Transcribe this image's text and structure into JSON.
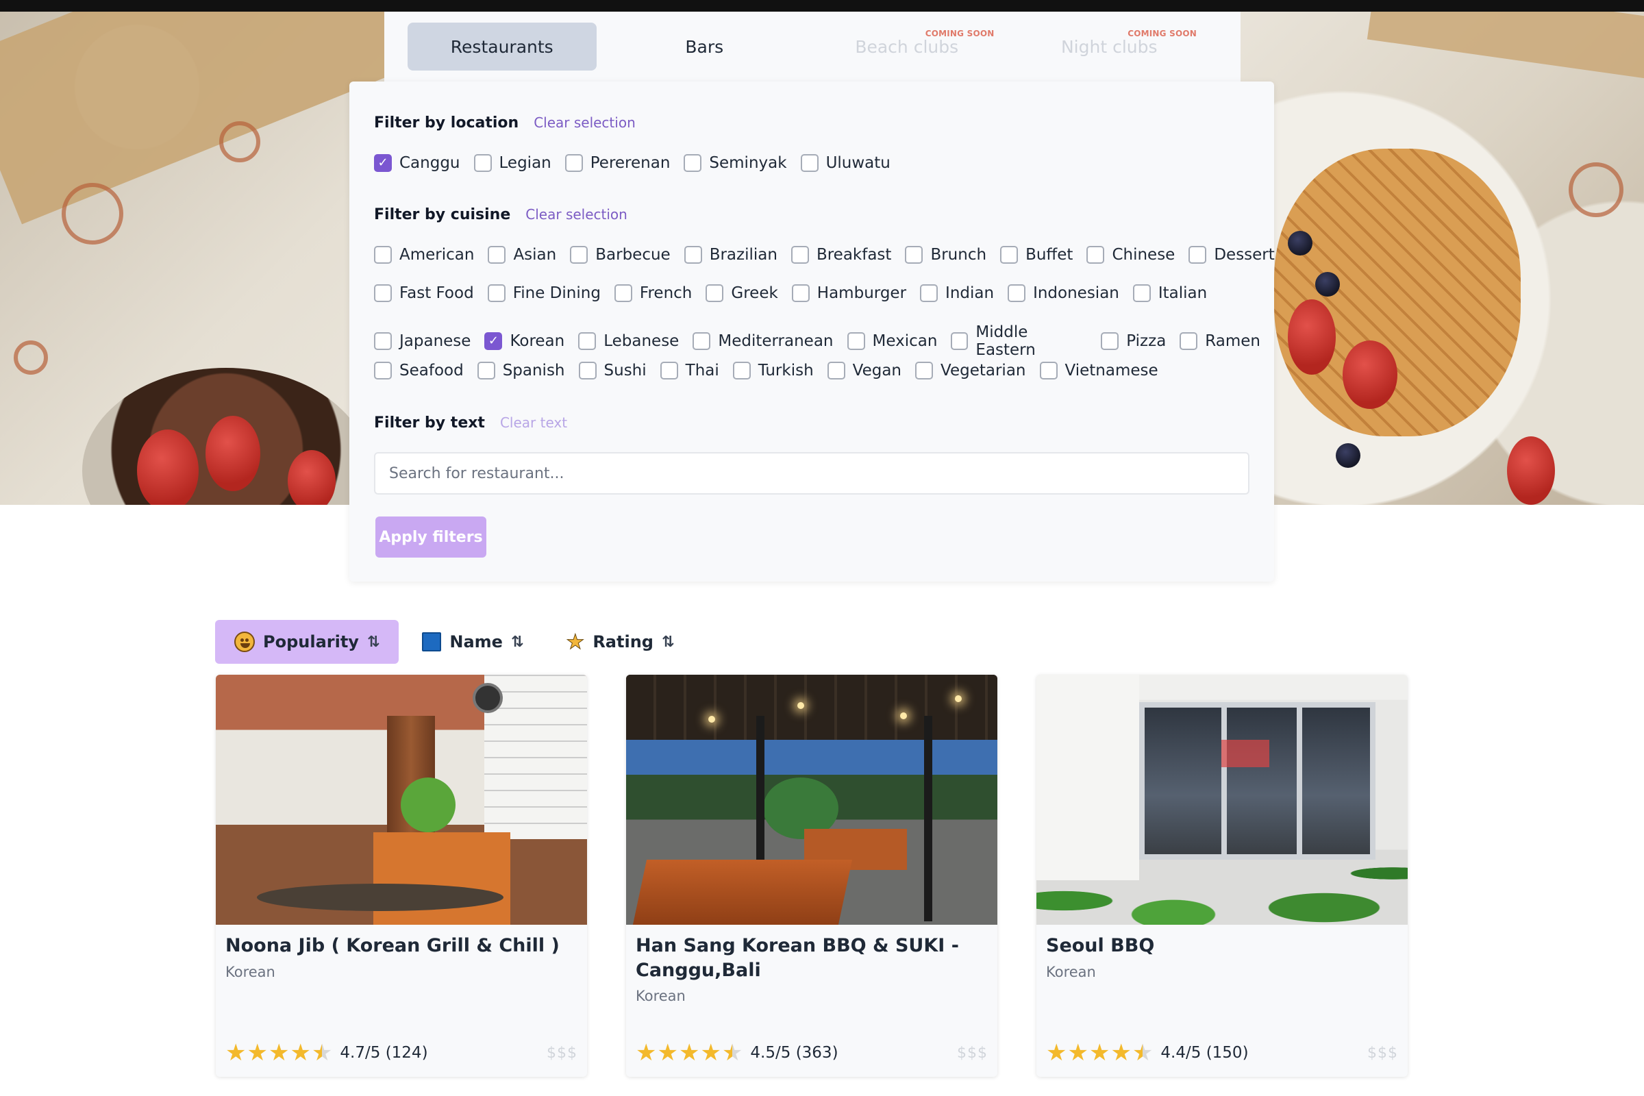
{
  "category_tabs": [
    {
      "label": "Restaurants",
      "state": "active",
      "badge": ""
    },
    {
      "label": "Bars",
      "state": "normal",
      "badge": ""
    },
    {
      "label": "Beach clubs",
      "state": "disabled",
      "badge": "COMING SOON"
    },
    {
      "label": "Night clubs",
      "state": "disabled",
      "badge": "COMING SOON"
    }
  ],
  "filters": {
    "location": {
      "title": "Filter by location",
      "clear": "Clear selection",
      "options": [
        {
          "label": "Canggu",
          "checked": true
        },
        {
          "label": "Legian",
          "checked": false
        },
        {
          "label": "Pererenan",
          "checked": false
        },
        {
          "label": "Seminyak",
          "checked": false
        },
        {
          "label": "Uluwatu",
          "checked": false
        }
      ]
    },
    "cuisine": {
      "title": "Filter by cuisine",
      "clear": "Clear selection",
      "rows": [
        [
          {
            "label": "American",
            "checked": false
          },
          {
            "label": "Asian",
            "checked": false
          },
          {
            "label": "Barbecue",
            "checked": false
          },
          {
            "label": "Brazilian",
            "checked": false
          },
          {
            "label": "Breakfast",
            "checked": false
          },
          {
            "label": "Brunch",
            "checked": false
          },
          {
            "label": "Buffet",
            "checked": false
          },
          {
            "label": "Chinese",
            "checked": false
          },
          {
            "label": "Dessert",
            "checked": false
          }
        ],
        [
          {
            "label": "Fast Food",
            "checked": false
          },
          {
            "label": "Fine Dining",
            "checked": false
          },
          {
            "label": "French",
            "checked": false
          },
          {
            "label": "Greek",
            "checked": false
          },
          {
            "label": "Hamburger",
            "checked": false
          },
          {
            "label": "Indian",
            "checked": false
          },
          {
            "label": "Indonesian",
            "checked": false
          },
          {
            "label": "Italian",
            "checked": false
          }
        ],
        [
          {
            "label": "Japanese",
            "checked": false
          },
          {
            "label": "Korean",
            "checked": true
          },
          {
            "label": "Lebanese",
            "checked": false
          },
          {
            "label": "Mediterranean",
            "checked": false
          },
          {
            "label": "Mexican",
            "checked": false
          },
          {
            "label": "Middle Eastern",
            "checked": false
          },
          {
            "label": "Pizza",
            "checked": false
          },
          {
            "label": "Ramen",
            "checked": false
          }
        ],
        [
          {
            "label": "Seafood",
            "checked": false
          },
          {
            "label": "Spanish",
            "checked": false
          },
          {
            "label": "Sushi",
            "checked": false
          },
          {
            "label": "Thai",
            "checked": false
          },
          {
            "label": "Turkish",
            "checked": false
          },
          {
            "label": "Vegan",
            "checked": false
          },
          {
            "label": "Vegetarian",
            "checked": false
          },
          {
            "label": "Vietnamese",
            "checked": false
          }
        ]
      ]
    },
    "text": {
      "title": "Filter by text",
      "clear": "Clear text",
      "placeholder": "Search for restaurant...",
      "value": ""
    },
    "apply_label": "Apply filters"
  },
  "sort": [
    {
      "label": "Popularity",
      "icon": "grinning-face-icon",
      "active": true
    },
    {
      "label": "Name",
      "icon": "abc-icon",
      "active": false
    },
    {
      "label": "Rating",
      "icon": "star-icon",
      "active": false
    }
  ],
  "restaurants": [
    {
      "name": "Noona Jib ( Korean Grill & Chill )",
      "cuisine": "Korean",
      "stars": 4.7,
      "rating_text": "4.7/5 (124)",
      "price": "$$$"
    },
    {
      "name": "Han Sang Korean BBQ & SUKI - Canggu,Bali",
      "cuisine": "Korean",
      "stars": 4.5,
      "rating_text": "4.5/5 (363)",
      "price": "$$$"
    },
    {
      "name": "Seoul BBQ",
      "cuisine": "Korean",
      "stars": 4.4,
      "rating_text": "4.4/5 (150)",
      "price": "$$$"
    }
  ],
  "colors": {
    "accent": "#7b57d1",
    "active_sort_bg": "#d5b8f7",
    "apply_bg": "#c9a8f2",
    "star": "#f3b92c",
    "coming_soon": "#e07a6a"
  }
}
